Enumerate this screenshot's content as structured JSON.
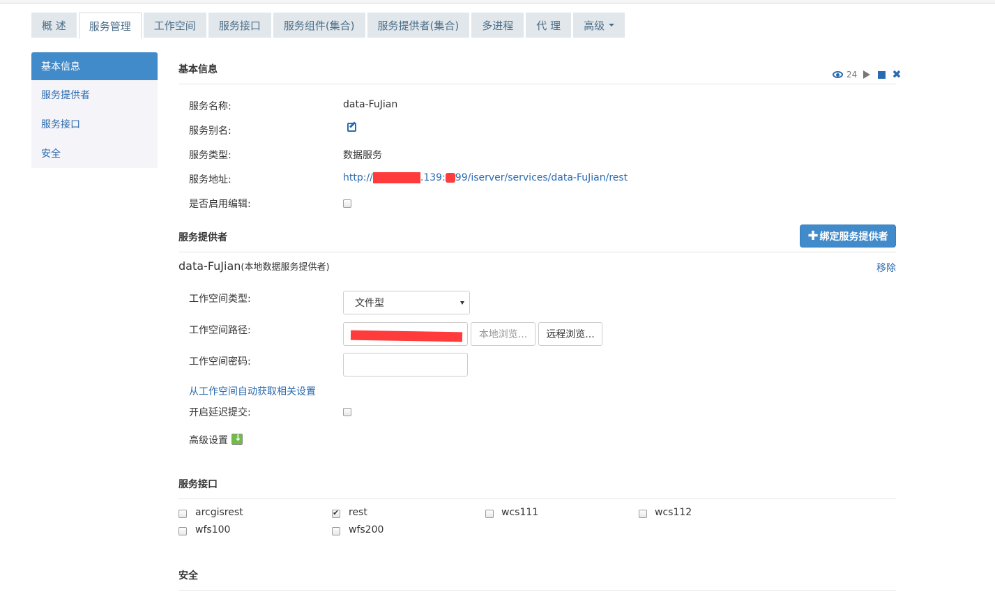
{
  "tabs": [
    {
      "label": "概 述",
      "active": false
    },
    {
      "label": "服务管理",
      "active": true
    },
    {
      "label": "工作空间",
      "active": false
    },
    {
      "label": "服务接口",
      "active": false
    },
    {
      "label": "服务组件(集合)",
      "active": false
    },
    {
      "label": "服务提供者(集合)",
      "active": false
    },
    {
      "label": "多进程",
      "active": false
    },
    {
      "label": "代 理",
      "active": false
    },
    {
      "label": "高级",
      "active": false,
      "dropdown": true
    }
  ],
  "sidebar": {
    "items": [
      {
        "label": "基本信息",
        "active": true
      },
      {
        "label": "服务提供者",
        "active": false
      },
      {
        "label": "服务接口",
        "active": false
      },
      {
        "label": "安全",
        "active": false
      }
    ]
  },
  "basic": {
    "title": "基本信息",
    "view_count": "24",
    "name_label": "服务名称:",
    "name_value": "data-FuJian",
    "alias_label": "服务别名:",
    "type_label": "服务类型:",
    "type_value": "数据服务",
    "url_label": "服务地址:",
    "url_prefix": "http://",
    "url_mid": ".139:",
    "url_suffix": "99/iserver/services/data-FuJian/rest",
    "edit_label": "是否启用编辑:",
    "edit_enabled": false
  },
  "provider": {
    "title": "服务提供者",
    "bind_button": "绑定服务提供者",
    "name": "data-FuJian",
    "name_note": "(本地数据服务提供者)",
    "remove_link": "移除",
    "ws_type_label": "工作空间类型:",
    "ws_type_value": "文件型",
    "ws_path_label": "工作空间路径:",
    "local_browse": "本地浏览...",
    "remote_browse": "远程浏览...",
    "ws_password_label": "工作空间密码:",
    "ws_password_value": "",
    "auto_settings_link": "从工作空间自动获取相关设置",
    "delay_commit_label": "开启延迟提交:",
    "delay_commit": false,
    "advanced_label": "高级设置"
  },
  "interfaces": {
    "title": "服务接口",
    "items": [
      {
        "label": "arcgisrest",
        "checked": false
      },
      {
        "label": "rest",
        "checked": true
      },
      {
        "label": "wcs111",
        "checked": false
      },
      {
        "label": "wcs112",
        "checked": false
      },
      {
        "label": "wfs100",
        "checked": false
      },
      {
        "label": "wfs200",
        "checked": false
      }
    ]
  },
  "security": {
    "title": "安全"
  }
}
